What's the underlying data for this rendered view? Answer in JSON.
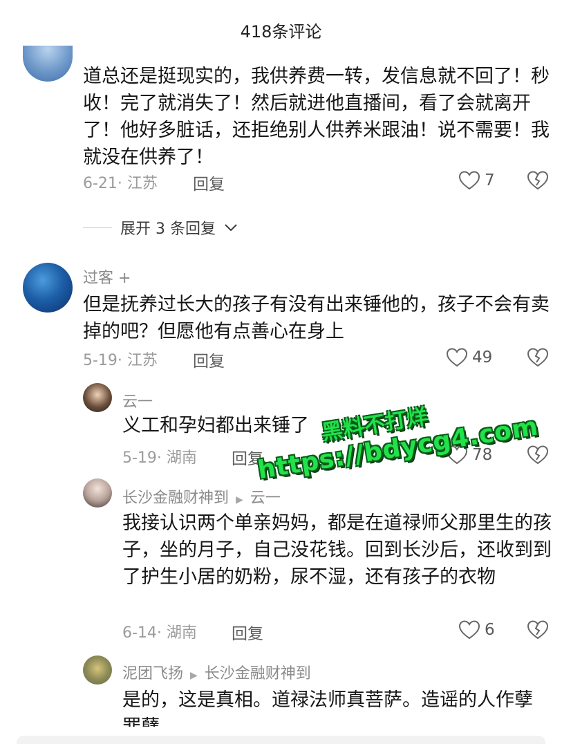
{
  "header": {
    "title": "418条评论"
  },
  "comments": [
    {
      "body": "道总还是挺现实的，我供养费一转，发信息就不回了！秒收！完了就消失了！然后就进他直播间，看了会就离开了！他好多脏话，还拒绝别人供养米跟油！说不需要！我就没在供养了！",
      "date_region": "6-21· 江苏",
      "reply_label": "回复",
      "likes": "7",
      "expand_label": "展开 3 条回复"
    },
    {
      "name": "过客 +",
      "body": "但是抚养过长大的孩子有没有出来锤他的，孩子不会有卖掉的吧？但愿他有点善心在身上",
      "date_region": "5-19· 江苏",
      "reply_label": "回复",
      "likes": "49",
      "replies": [
        {
          "name": "云一",
          "body": "义工和孕妇都出来锤了",
          "date_region": "5-19· 湖南",
          "reply_label": "回复",
          "likes": "78"
        },
        {
          "name": "长沙金融财神到",
          "reply_to": "云一",
          "body": "我接认识两个单亲妈妈，都是在道禄师父那里生的孩子，坐的月子，自己没花钱。回到长沙后，还收到到了护生小居的奶粉，尿不湿，还有孩子的衣物",
          "date_region": "6-14· 湖南",
          "reply_label": "回复",
          "likes": "6"
        },
        {
          "name": "泥团飞扬",
          "reply_to": "长沙金融财神到",
          "body": "是的，这是真相。道禄法师真菩萨。造谣的人作孽罪孽"
        }
      ]
    }
  ],
  "watermark": {
    "line1": "黑料不打烊",
    "line2": "https://bdycg4.com"
  },
  "colors": {
    "watermark": "#21e24b",
    "meta": "#9b9b9b",
    "name": "#8a8a8a"
  }
}
